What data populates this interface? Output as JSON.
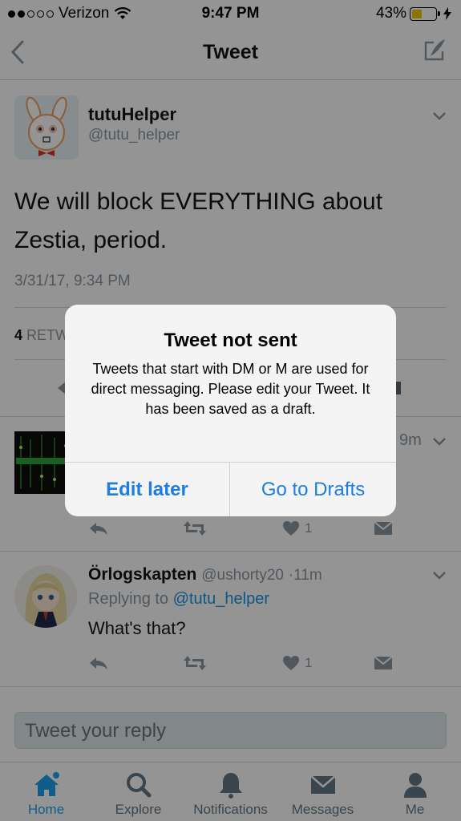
{
  "status_bar": {
    "carrier": "Verizon",
    "time": "9:47 PM",
    "battery": "43%"
  },
  "nav": {
    "title": "Tweet"
  },
  "tweet": {
    "author_name": "tutuHelper",
    "author_handle": "@tutu_helper",
    "text": "We will block EVERYTHING about Zestia, period.",
    "timestamp": "3/31/17, 9:34 PM",
    "retweet_count": "4",
    "retweet_label": "RETW"
  },
  "replies": [
    {
      "time": "9m",
      "like_count": "1"
    },
    {
      "name": "Örlogskapten",
      "handle": "@ushorty20",
      "time": "11m",
      "replying_prefix": "Replying to",
      "replying_to": "@tutu_helper",
      "text": "What's that?",
      "like_count": "1"
    }
  ],
  "reply_box": {
    "placeholder": "Tweet your reply"
  },
  "tabs": [
    {
      "label": "Home",
      "icon": "home-icon",
      "active": true
    },
    {
      "label": "Explore",
      "icon": "search-icon"
    },
    {
      "label": "Notifications",
      "icon": "bell-icon"
    },
    {
      "label": "Messages",
      "icon": "envelope-icon"
    },
    {
      "label": "Me",
      "icon": "person-icon"
    }
  ],
  "alert": {
    "title": "Tweet not sent",
    "message": "Tweets that start with DM or M are used for direct messaging. Please edit your Tweet. It has been saved as a draft.",
    "buttons": {
      "edit_later": "Edit later",
      "go_to_drafts": "Go to Drafts"
    }
  },
  "colors": {
    "accent": "#1da1f2",
    "alert_button": "#1d7ee0",
    "muted": "#8a96a1"
  }
}
